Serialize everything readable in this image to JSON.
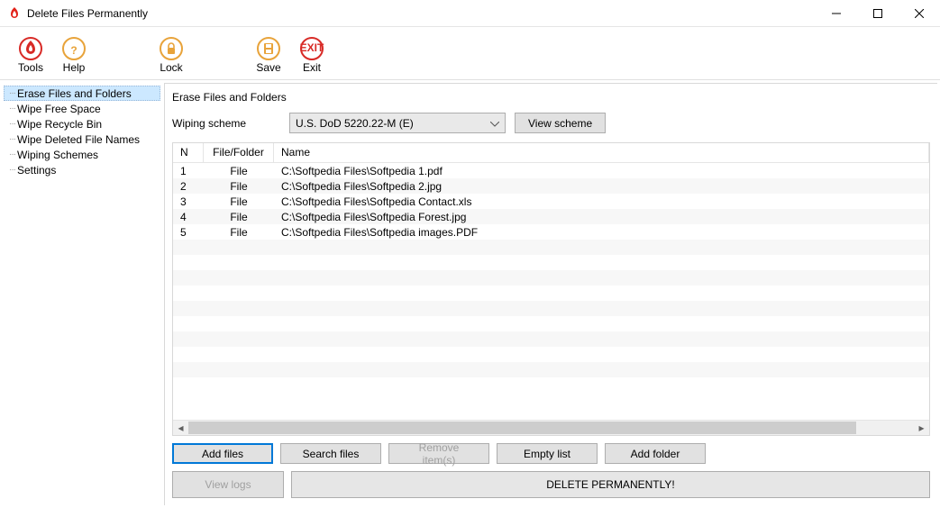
{
  "window": {
    "title": "Delete Files Permanently"
  },
  "toolbar": {
    "tools": "Tools",
    "help": "Help",
    "lock": "Lock",
    "save": "Save",
    "exit": "Exit",
    "exit_glyph": "EXIT"
  },
  "sidebar": {
    "items": [
      "Erase Files and Folders",
      "Wipe Free Space",
      "Wipe Recycle Bin",
      "Wipe Deleted File Names",
      "Wiping Schemes",
      "Settings"
    ]
  },
  "panel": {
    "title": "Erase Files and Folders",
    "scheme_label": "Wiping scheme",
    "scheme_value": "U.S. DoD 5220.22-M (E)",
    "view_scheme": "View scheme"
  },
  "grid": {
    "headers": {
      "n": "N",
      "ff": "File/Folder",
      "name": "Name"
    },
    "rows": [
      {
        "n": "1",
        "ff": "File",
        "name": "C:\\Softpedia Files\\Softpedia 1.pdf"
      },
      {
        "n": "2",
        "ff": "File",
        "name": "C:\\Softpedia Files\\Softpedia 2.jpg"
      },
      {
        "n": "3",
        "ff": "File",
        "name": "C:\\Softpedia Files\\Softpedia Contact.xls"
      },
      {
        "n": "4",
        "ff": "File",
        "name": "C:\\Softpedia Files\\Softpedia Forest.jpg"
      },
      {
        "n": "5",
        "ff": "File",
        "name": "C:\\Softpedia Files\\Softpedia images.PDF"
      }
    ]
  },
  "buttons": {
    "add_files": "Add files",
    "search_files": "Search files",
    "remove_items": "Remove item(s)",
    "empty_list": "Empty list",
    "add_folder": "Add folder",
    "view_logs": "View logs",
    "delete": "DELETE PERMANENTLY!"
  }
}
